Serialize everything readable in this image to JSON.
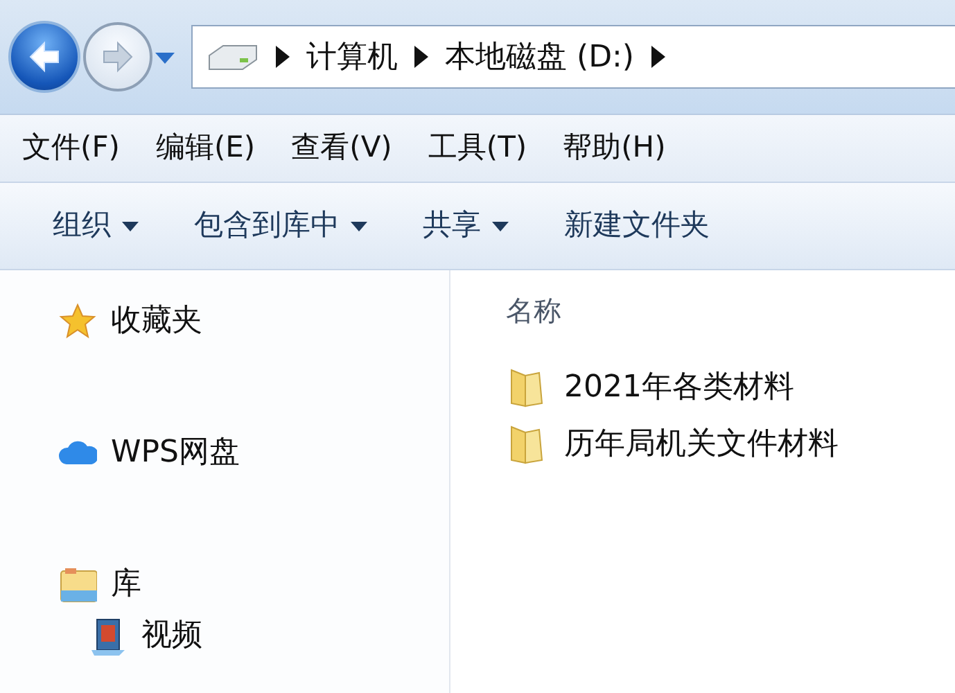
{
  "nav_buttons": [
    {
      "kind": "back",
      "disabled": false
    },
    {
      "kind": "forward",
      "disabled": true
    }
  ],
  "address": {
    "path": [
      "计算机",
      "本地磁盘 (D:)"
    ]
  },
  "menu": [
    "文件(F)",
    "编辑(E)",
    "查看(V)",
    "工具(T)",
    "帮助(H)"
  ],
  "toolbar": [
    {
      "label": "组织",
      "dropdown": true
    },
    {
      "label": "包含到库中",
      "dropdown": true
    },
    {
      "label": "共享",
      "dropdown": true
    },
    {
      "label": "新建文件夹",
      "dropdown": false
    }
  ],
  "sidebar": {
    "items": [
      {
        "label": "收藏夹",
        "kind": "favorites"
      },
      {
        "label": "WPS网盘",
        "kind": "cloud"
      },
      {
        "label": "库",
        "kind": "library",
        "children": [
          {
            "label": "视频",
            "kind": "video"
          }
        ]
      }
    ]
  },
  "file_list": {
    "columns": [
      "名称"
    ],
    "rows": [
      {
        "name": "2021年各类材料",
        "kind": "folder"
      },
      {
        "name": "历年局机关文件材料",
        "kind": "folder"
      }
    ]
  }
}
